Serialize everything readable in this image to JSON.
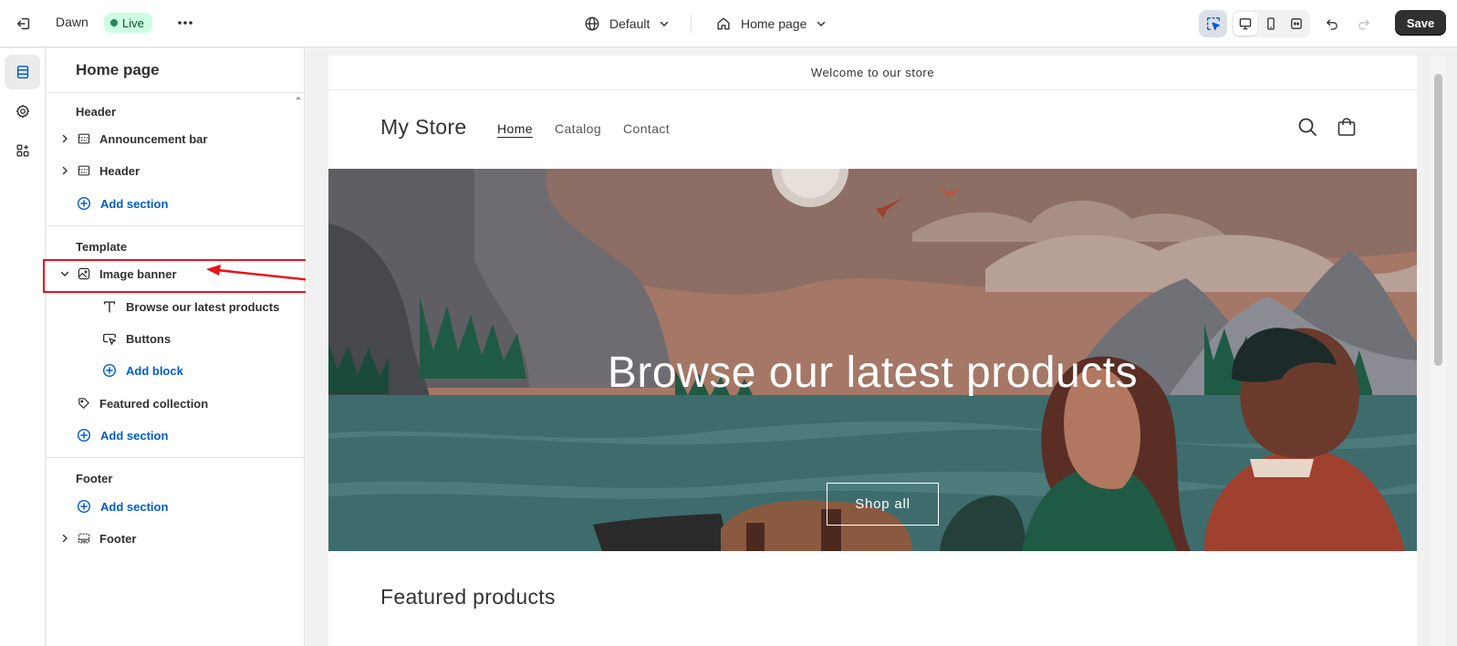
{
  "topbar": {
    "theme_name": "Dawn",
    "status": "Live",
    "template_selector": "Default",
    "page_selector": "Home page",
    "save_label": "Save",
    "icons": [
      "exit-icon",
      "more-icon",
      "globe-icon",
      "chevron-down-icon",
      "home-icon",
      "inspector-icon",
      "desktop-icon",
      "mobile-icon",
      "fullscreen-icon",
      "undo-icon",
      "redo-icon"
    ]
  },
  "rail": {
    "items": [
      {
        "name": "sections",
        "icon": "sections-icon"
      },
      {
        "name": "theme-settings",
        "icon": "gear-icon"
      },
      {
        "name": "app-embeds",
        "icon": "apps-icon"
      }
    ]
  },
  "sidebar": {
    "title": "Home page",
    "groups": [
      {
        "label": "Header",
        "items": [
          "Announcement bar",
          "Header"
        ],
        "add": "Add section"
      },
      {
        "label": "Template",
        "section": "Image banner",
        "blocks": [
          "Browse our latest products",
          "Buttons"
        ],
        "add_block": "Add block",
        "items": [
          "Featured collection"
        ],
        "add": "Add section"
      },
      {
        "label": "Footer",
        "add": "Add section",
        "items": [
          "Footer"
        ]
      }
    ]
  },
  "store": {
    "announcement": "Welcome to our store",
    "name": "My Store",
    "nav": [
      "Home",
      "Catalog",
      "Contact"
    ],
    "banner_heading": "Browse our latest products",
    "banner_button": "Shop all",
    "featured_heading": "Featured products"
  },
  "colors": {
    "accent": "#005bd3",
    "live_bg": "#cdfee1",
    "live_dot": "#29845a",
    "highlight": "#e8141b",
    "save_bg": "#303030"
  }
}
